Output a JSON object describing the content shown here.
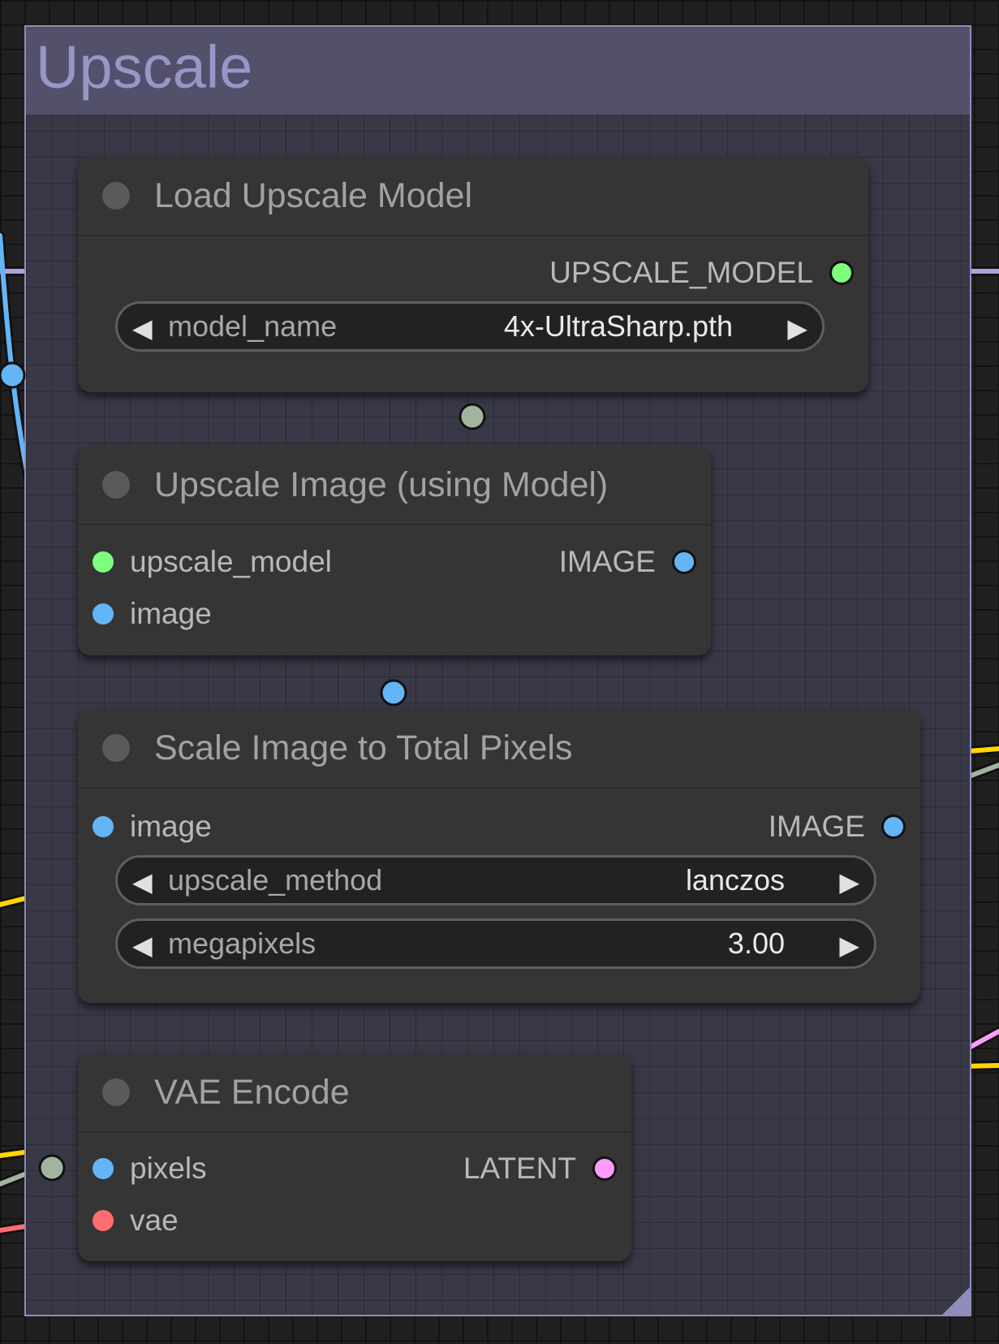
{
  "group": {
    "title": "Upscale"
  },
  "nodes": {
    "load_upscale_model": {
      "title": "Load Upscale Model",
      "output_label": "UPSCALE_MODEL",
      "widget": {
        "name": "model_name",
        "value": "4x-UltraSharp.pth"
      }
    },
    "upscale_image": {
      "title": "Upscale Image (using Model)",
      "inputs": [
        "upscale_model",
        "image"
      ],
      "output_label": "IMAGE"
    },
    "scale_image": {
      "title": "Scale Image to Total Pixels",
      "inputs": [
        "image"
      ],
      "output_label": "IMAGE",
      "widgets": [
        {
          "name": "upscale_method",
          "value": "lanczos"
        },
        {
          "name": "megapixels",
          "value": "3.00"
        }
      ]
    },
    "vae_encode": {
      "title": "VAE Encode",
      "inputs": [
        "pixels",
        "vae"
      ],
      "output_label": "LATENT"
    }
  },
  "colors": {
    "model": "#7dff7d",
    "image": "#64b5f6",
    "latent": "#ff9cf9",
    "vae": "#ff6e6e",
    "clip": "#ffd500",
    "upscale_link": "#b39ddb",
    "misc_link": "#a1b4a0"
  }
}
